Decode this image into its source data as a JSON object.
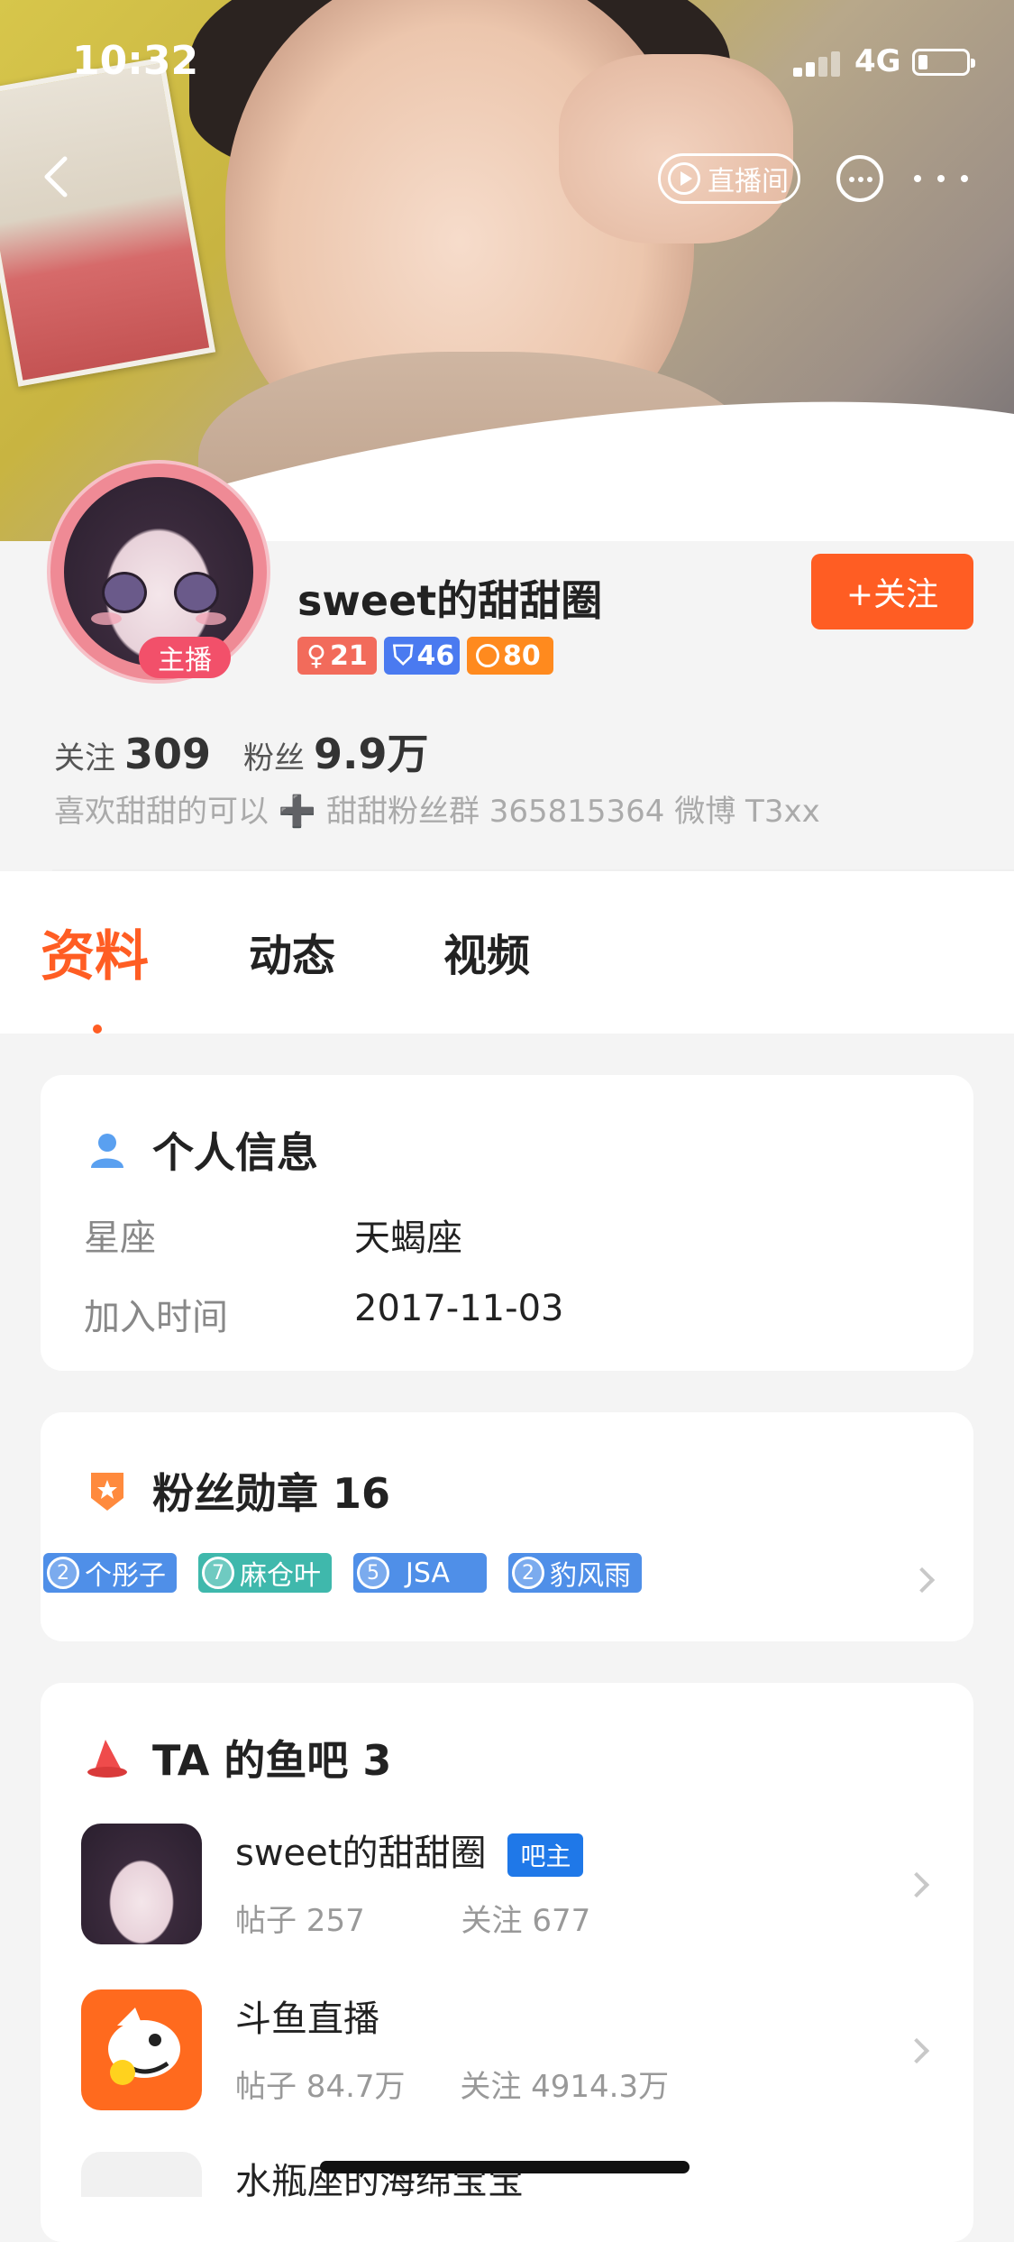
{
  "status_bar": {
    "time": "10:32",
    "network": "4G"
  },
  "nav": {
    "live_room_label": "直播间"
  },
  "profile": {
    "anchor_badge": "主播",
    "nickname": "sweet的甜甜圈",
    "follow_label": "+关注",
    "badges": {
      "gender_age": "21",
      "rank": "46",
      "level": "80"
    },
    "following_label": "关注",
    "following_count": "309",
    "fans_label": "粉丝",
    "fans_count": "9.9万",
    "bio": "喜欢甜甜的可以 ➕ 甜甜粉丝群 365815364 微博 T3xx"
  },
  "tabs": [
    {
      "label": "资料",
      "active": true
    },
    {
      "label": "动态",
      "active": false
    },
    {
      "label": "视频",
      "active": false
    }
  ],
  "personal_info": {
    "title": "个人信息",
    "rows": [
      {
        "key": "星座",
        "value": "天蝎座"
      },
      {
        "key": "加入时间",
        "value": "2017-11-03"
      }
    ]
  },
  "fan_medals": {
    "title": "粉丝勋章 16",
    "items": [
      {
        "level": "2",
        "name": "个彤子",
        "color": "#4f8fe8"
      },
      {
        "level": "7",
        "name": "麻仓叶",
        "color": "#3fb8ac"
      },
      {
        "level": "5",
        "name": "JSA",
        "color": "#4f8fe8"
      },
      {
        "level": "2",
        "name": "豹风雨",
        "color": "#4f8fe8"
      }
    ]
  },
  "fish_bars": {
    "title": "TA 的鱼吧 3",
    "items": [
      {
        "name": "sweet的甜甜圈",
        "tag": "吧主",
        "posts": "帖子 257",
        "follows": "关注 677"
      },
      {
        "name": "斗鱼直播",
        "tag": "",
        "posts": "帖子 84.7万",
        "follows": "关注 4914.3万"
      },
      {
        "name": "水瓶座的海绵宝宝",
        "tag": "",
        "posts": "",
        "follows": ""
      }
    ]
  },
  "colors": {
    "accent": "#ff5d23",
    "owner_tag": "#1f78e8"
  }
}
